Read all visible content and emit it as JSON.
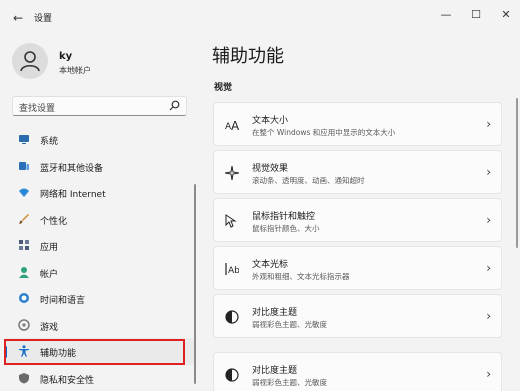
{
  "window": {
    "title": "设置",
    "back_glyph": "←",
    "min_glyph": "—",
    "max_glyph": "☐",
    "close_glyph": "✕"
  },
  "user": {
    "name": "ky",
    "account_type": "本地帐户"
  },
  "search": {
    "placeholder": "查找设置"
  },
  "nav": {
    "items": [
      {
        "label": "系统",
        "icon": "monitor-icon",
        "color": "#2b6cb0"
      },
      {
        "label": "蓝牙和其他设备",
        "icon": "bluetooth-devices-icon",
        "color": "#2a6fb8"
      },
      {
        "label": "网络和 Internet",
        "icon": "wifi-icon",
        "color": "#2b88d8"
      },
      {
        "label": "个性化",
        "icon": "brush-icon",
        "color": "#d08a2c"
      },
      {
        "label": "应用",
        "icon": "apps-icon",
        "color": "#4a5a78"
      },
      {
        "label": "帐户",
        "icon": "person-icon",
        "color": "#2fa37a"
      },
      {
        "label": "时间和语言",
        "icon": "globe-clock-icon",
        "color": "#2b7fd0"
      },
      {
        "label": "游戏",
        "icon": "gamepad-icon",
        "color": "#7a7a7a"
      },
      {
        "label": "辅助功能",
        "icon": "accessibility-icon",
        "color": "#1e6fc8"
      },
      {
        "label": "隐私和安全性",
        "icon": "shield-icon",
        "color": "#6a6a6a"
      }
    ],
    "active_index": 8
  },
  "main": {
    "title": "辅助功能",
    "section": "视觉",
    "cards": [
      {
        "title": "文本大小",
        "desc": "在整个 Windows 和应用中显示的文本大小",
        "icon": "text-size-icon"
      },
      {
        "title": "视觉效果",
        "desc": "滚动条、透明度、动画、通知超时",
        "icon": "sparkle-icon"
      },
      {
        "title": "鼠标指针和触控",
        "desc": "鼠标指针颜色、大小",
        "icon": "mouse-pointer-icon"
      },
      {
        "title": "文本光标",
        "desc": "外观和粗细、文本光标指示器",
        "icon": "text-cursor-icon"
      },
      {
        "title": "对比度主题",
        "desc": "弱视彩色主题、光敏度",
        "icon": "contrast-icon"
      },
      {
        "title": "对比度主题",
        "desc": "弱视彩色主题、光敏度",
        "icon": "contrast-icon"
      }
    ],
    "chevron": "›"
  },
  "colors": {
    "accent": "#0067c0",
    "highlight": "#e02020"
  }
}
